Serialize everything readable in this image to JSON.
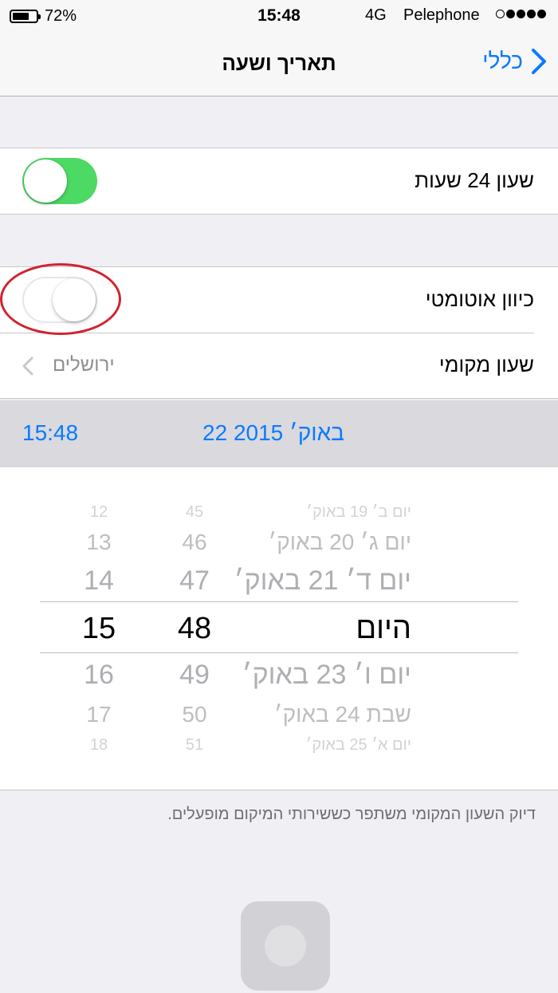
{
  "status_bar": {
    "battery_percent": "72%",
    "battery_level": 0.72,
    "time": "15:48",
    "network": "4G",
    "carrier": "Pelephone",
    "signal_bars_filled": 4,
    "signal_bars_total": 5
  },
  "nav": {
    "title": "תאריך ושעה",
    "back_label": "כללי"
  },
  "settings": {
    "clock_24h": {
      "label": "שעון 24 שעות",
      "enabled": true
    },
    "auto_set": {
      "label": "כיוון אוטומטי",
      "enabled": false
    },
    "timezone": {
      "label": "שעון מקומי",
      "value": "ירושלים"
    }
  },
  "date_display": {
    "date": "22 באוק׳ 2015",
    "time": "15:48"
  },
  "picker": {
    "dates": [
      "יום ב׳ 19 באוק׳",
      "יום ג׳ 20 באוק׳",
      "יום ד׳ 21 באוק׳",
      "היום",
      "יום ו׳ 23 באוק׳",
      "שבת 24 באוק׳",
      "יום א׳ 25 באוק׳"
    ],
    "minutes": [
      "45",
      "46",
      "47",
      "48",
      "49",
      "50",
      "51"
    ],
    "hours": [
      "12",
      "13",
      "14",
      "15",
      "16",
      "17",
      "18"
    ],
    "selected_index": 3
  },
  "footer_note": "דיוק השעון המקומי משתפר כששירותי המיקום מופעלים.",
  "colors": {
    "accent": "#0a7aff",
    "toggle_on": "#4cd964",
    "annotation_circle": "#d0232e"
  }
}
